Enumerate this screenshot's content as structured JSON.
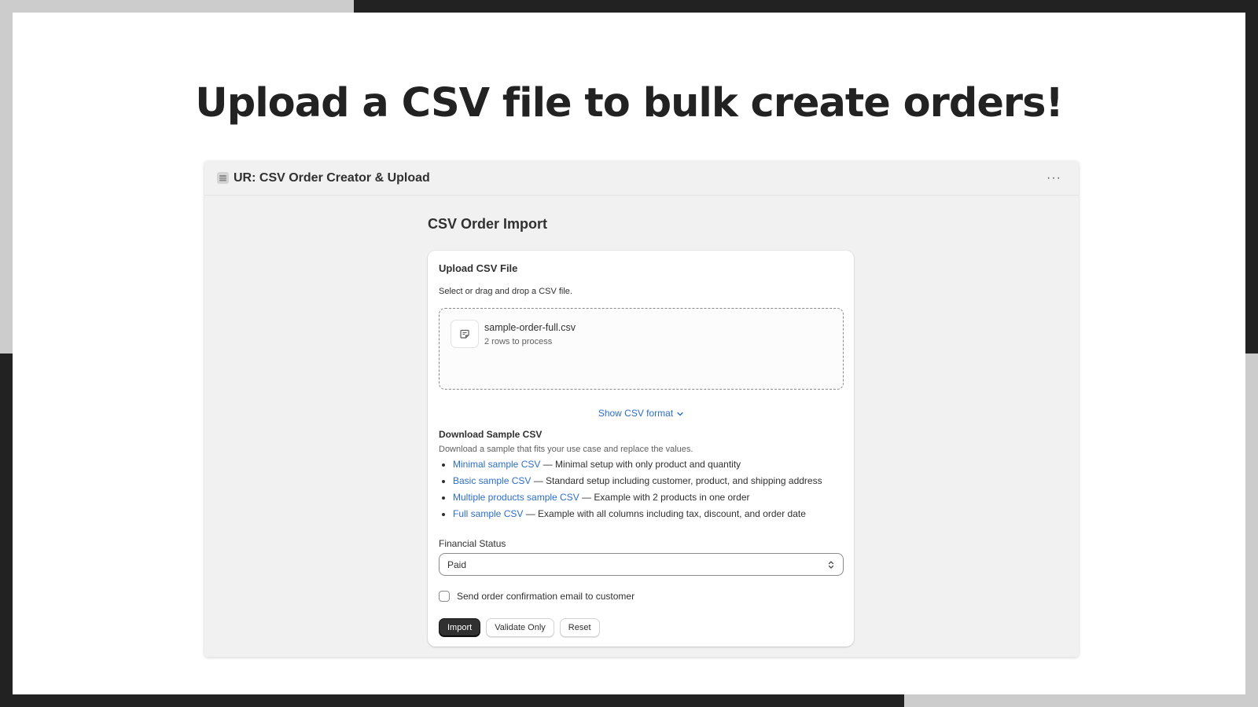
{
  "headline": "Upload a CSV file to bulk create orders!",
  "app": {
    "title": "UR: CSV Order Creator & Upload",
    "more_label": "···"
  },
  "page": {
    "title": "CSV Order Import"
  },
  "upload": {
    "title": "Upload CSV File",
    "description": "Select or drag and drop a CSV file.",
    "file_name": "sample-order-full.csv",
    "file_rows": "2 rows to process",
    "toggle_label": "Show CSV format"
  },
  "download": {
    "title": "Download Sample CSV",
    "description": "Download a sample that fits your use case and replace the values.",
    "items": [
      {
        "link": "Minimal sample CSV",
        "text": " — Minimal setup with only product and quantity"
      },
      {
        "link": "Basic sample CSV",
        "text": " — Standard setup including customer, product, and shipping address"
      },
      {
        "link": "Multiple products sample CSV",
        "text": " — Example with 2 products in one order"
      },
      {
        "link": "Full sample CSV",
        "text": " — Example with all columns including tax, discount, and order date"
      }
    ]
  },
  "financial_status": {
    "label": "Financial Status",
    "selected": "Paid"
  },
  "email_checkbox": {
    "label": "Send order confirmation email to customer",
    "checked": false
  },
  "buttons": {
    "import": "Import",
    "validate": "Validate Only",
    "reset": "Reset"
  },
  "colors": {
    "page_frame": "#222222",
    "frame_accent": "#cccccc",
    "link": "#2c6ecb",
    "primary_button": "#303030"
  }
}
